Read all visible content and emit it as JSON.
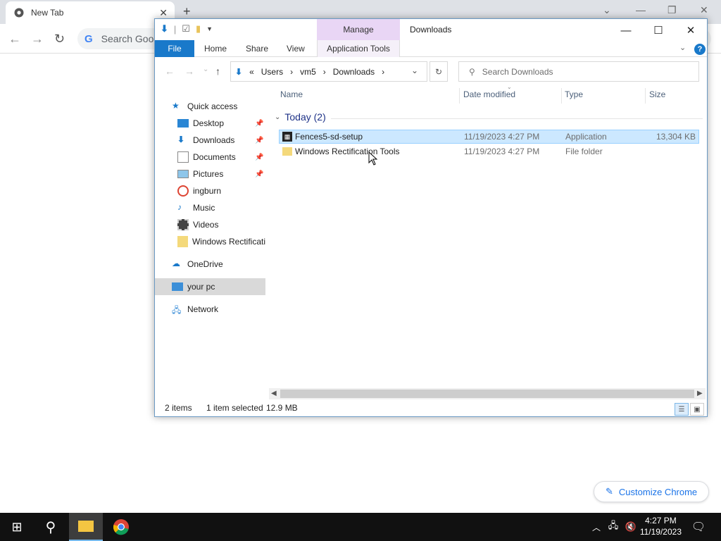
{
  "chrome": {
    "tab_title": "New Tab",
    "search_placeholder": "Search Goog",
    "customize_label": "Customize Chrome"
  },
  "explorer": {
    "qat_separator": "|",
    "manage_label": "Manage",
    "title": "Downloads",
    "ribbon_tabs": [
      "File",
      "Home",
      "Share",
      "View",
      "Application Tools"
    ],
    "breadcrumb": [
      "«",
      "Users",
      "vm5",
      "Downloads"
    ],
    "search_placeholder": "Search Downloads",
    "nav": {
      "quick_access": "Quick access",
      "items": [
        "Desktop",
        "Downloads",
        "Documents",
        "Pictures",
        "ingburn",
        "Music",
        "Videos",
        "Windows Rectificati"
      ],
      "onedrive": "OneDrive",
      "your_pc": "your pc",
      "network": "Network"
    },
    "columns": [
      "Name",
      "Date modified",
      "Type",
      "Size"
    ],
    "group": "Today (2)",
    "files": [
      {
        "name": "Fences5-sd-setup",
        "date": "11/19/2023 4:27 PM",
        "type": "Application",
        "size": "13,304 KB"
      },
      {
        "name": "Windows Rectification Tools",
        "date": "11/19/2023 4:27 PM",
        "type": "File folder",
        "size": ""
      }
    ],
    "status": {
      "count": "2 items",
      "selected": "1 item selected",
      "size": "12.9 MB"
    }
  },
  "taskbar": {
    "time": "4:27 PM",
    "date": "11/19/2023"
  },
  "colors": {
    "accent": "#1979ca",
    "manage": "#e9d6f5",
    "selection": "#cce8ff"
  }
}
